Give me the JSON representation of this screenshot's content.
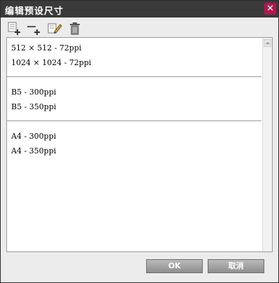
{
  "window": {
    "title": "编辑预设尺寸"
  },
  "toolbar": {
    "tools": [
      {
        "icon": "add-preset-icon"
      },
      {
        "icon": "add-separator-icon"
      },
      {
        "icon": "edit-pencil-icon"
      },
      {
        "icon": "trash-icon"
      }
    ]
  },
  "list": {
    "groups": [
      {
        "items": [
          "512 × 512 - 72ppi",
          "1024 × 1024 - 72ppi"
        ]
      },
      {
        "items": [
          "B5 - 300ppi",
          "B5 - 350ppi"
        ]
      },
      {
        "items": [
          "A4 - 300ppi",
          "A4 - 350ppi"
        ]
      }
    ]
  },
  "buttons": {
    "ok": "OK",
    "cancel": "取消"
  },
  "colors": {
    "titlebar": "#3a3a3a",
    "close": "#b0174f",
    "button": "#a8a8a8"
  }
}
